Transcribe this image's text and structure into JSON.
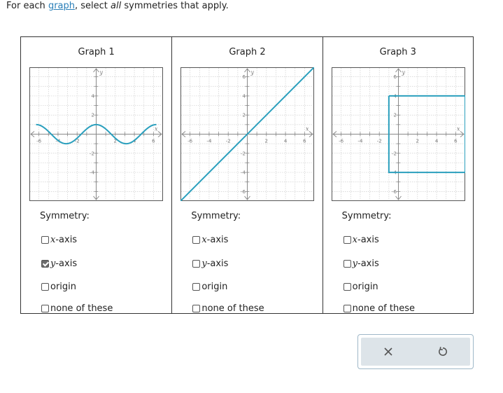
{
  "prompt": {
    "prefix": "For each ",
    "link": "graph",
    "middle": ", select ",
    "emphasis": "all",
    "suffix": " symmetries that apply."
  },
  "colors": {
    "curve": "#2a9fbd",
    "link": "#2a7fb8",
    "checked": "#6c6c6c"
  },
  "symmetry_label": "Symmetry:",
  "graphs": [
    {
      "title": "Graph 1",
      "axis_labels": {
        "x": "x",
        "y": "y"
      },
      "x_ticks": [
        "-6",
        "-4",
        "-2",
        "2",
        "4",
        "6"
      ],
      "y_ticks": [
        "4",
        "2",
        "-2",
        "-4"
      ],
      "chart_data": {
        "type": "line",
        "curve": "y = cos(x)",
        "x_range": [
          -6.3,
          6.3
        ],
        "ylim": [
          -7,
          7
        ],
        "xlim": [
          -7,
          7
        ]
      },
      "options": [
        {
          "math": "x",
          "text": "-axis",
          "checked": false
        },
        {
          "math": "y",
          "text": "-axis",
          "checked": true
        },
        {
          "math": "",
          "text": "origin",
          "checked": false
        },
        {
          "math": "",
          "text": "none of these",
          "checked": false
        }
      ]
    },
    {
      "title": "Graph 2",
      "axis_labels": {
        "x": "x",
        "y": "y"
      },
      "x_ticks": [
        "-6",
        "-4",
        "-2",
        "2",
        "4",
        "6"
      ],
      "y_ticks": [
        "6",
        "4",
        "2",
        "-2",
        "-4",
        "-6"
      ],
      "chart_data": {
        "type": "line",
        "curve": "y = x",
        "points": [
          [
            -7,
            -7
          ],
          [
            7,
            7
          ]
        ],
        "ylim": [
          -7,
          7
        ],
        "xlim": [
          -7,
          7
        ]
      },
      "options": [
        {
          "math": "x",
          "text": "-axis",
          "checked": false
        },
        {
          "math": "y",
          "text": "-axis",
          "checked": false
        },
        {
          "math": "",
          "text": "origin",
          "checked": false
        },
        {
          "math": "",
          "text": "none of these",
          "checked": false
        }
      ]
    },
    {
      "title": "Graph 3",
      "axis_labels": {
        "x": "x",
        "y": "y"
      },
      "x_ticks": [
        "-6",
        "-4",
        "-2",
        "2",
        "4",
        "6"
      ],
      "y_ticks": [
        "6",
        "4",
        "2",
        "-2",
        "-4",
        "-6"
      ],
      "chart_data": {
        "type": "line",
        "curve": "square",
        "points": [
          [
            -1,
            4
          ],
          [
            7,
            4
          ],
          [
            7,
            -4
          ],
          [
            -1,
            -4
          ],
          [
            -1,
            4
          ]
        ],
        "ylim": [
          -7,
          7
        ],
        "xlim": [
          -7,
          7
        ]
      },
      "options": [
        {
          "math": "x",
          "text": "-axis",
          "checked": false
        },
        {
          "math": "y",
          "text": "-axis",
          "checked": false
        },
        {
          "math": "",
          "text": "origin",
          "checked": false
        },
        {
          "math": "",
          "text": "none of these",
          "checked": false
        }
      ]
    }
  ],
  "toolbar": {
    "clear_icon": "close-icon",
    "undo_icon": "undo-icon"
  }
}
